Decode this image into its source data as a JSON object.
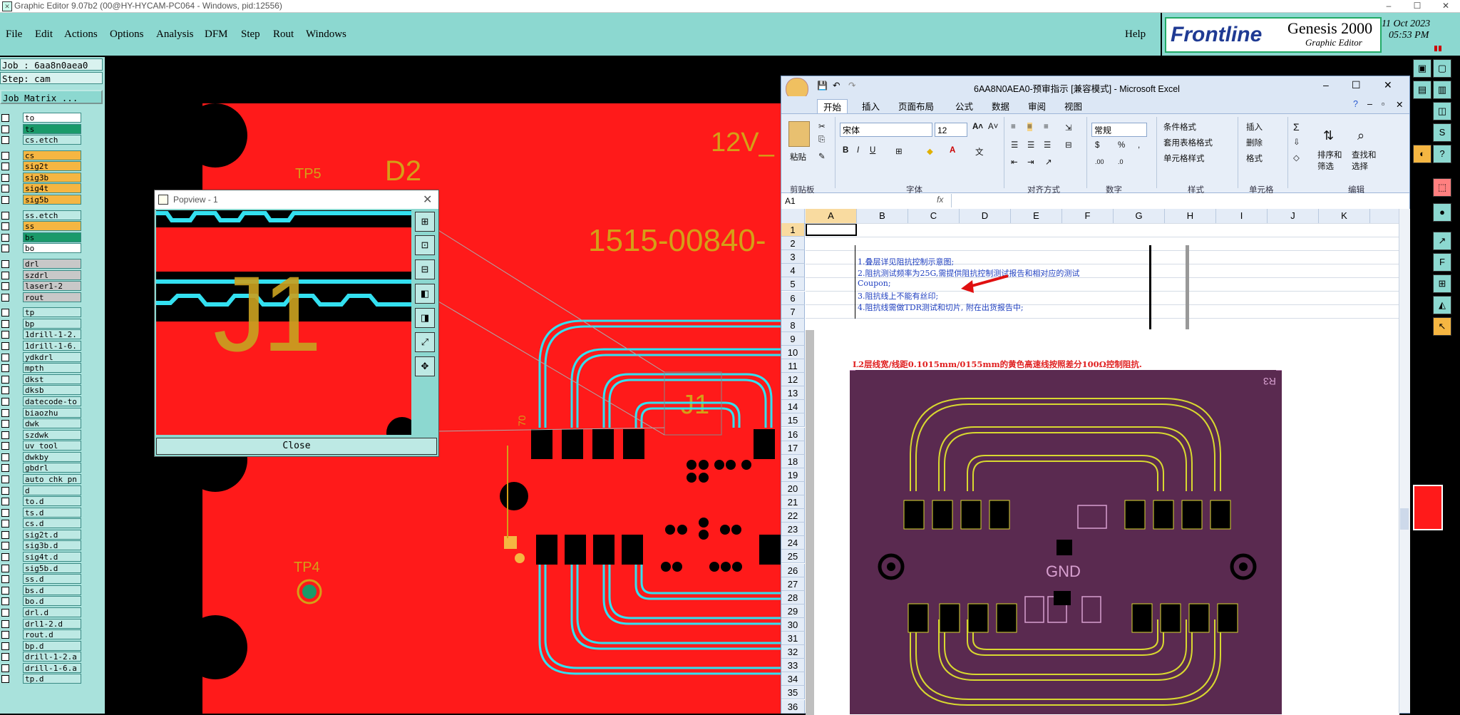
{
  "window": {
    "title": "Graphic Editor 9.07b2 (00@HY-HYCAM-PC064 - Windows, pid:12556)",
    "controls": [
      "–",
      "☐",
      "✕"
    ]
  },
  "menu": {
    "items": [
      "File",
      "Edit",
      "Actions",
      "Options",
      "Analysis",
      "DFM",
      "Step",
      "Rout",
      "Windows"
    ],
    "help": "Help"
  },
  "brand": {
    "logo": "Frontline",
    "product": "Genesis 2000",
    "subtitle": "Graphic Editor",
    "date": "11 Oct 2023",
    "time": "05:53 PM"
  },
  "job": {
    "job_line": "Job : 6aa8n0aea0",
    "step_line": "Step: cam",
    "matrix_button": "Job Matrix ..."
  },
  "layers": [
    {
      "name": "to",
      "color": "#ffffff"
    },
    {
      "name": "ts",
      "color": "#1a9a6a"
    },
    {
      "name": "cs.etch",
      "color": "#bde9e4"
    },
    {
      "name": "cs",
      "color": "#f5b642"
    },
    {
      "name": "sig2t",
      "color": "#f5b642"
    },
    {
      "name": "sig3b",
      "color": "#f5b642"
    },
    {
      "name": "sig4t",
      "color": "#f5b642"
    },
    {
      "name": "sig5b",
      "color": "#f5b642"
    },
    {
      "name": "ss.etch",
      "color": "#bde9e4"
    },
    {
      "name": "ss",
      "color": "#f5b642"
    },
    {
      "name": "bs",
      "color": "#1a9a6a"
    },
    {
      "name": "bo",
      "color": "#ffffff"
    },
    {
      "name": "drl",
      "color": "#c8c8c8"
    },
    {
      "name": "szdrl",
      "color": "#c8c8c8"
    },
    {
      "name": "laser1-2",
      "color": "#c8c8c8"
    },
    {
      "name": "rout",
      "color": "#c8c8c8"
    },
    {
      "name": "tp",
      "color": "#bde9e4"
    },
    {
      "name": "bp",
      "color": "#bde9e4"
    },
    {
      "name": "1drill-1-2.",
      "color": "#bde9e4"
    },
    {
      "name": "1drill-1-6.",
      "color": "#bde9e4"
    },
    {
      "name": "ydkdrl",
      "color": "#bde9e4"
    },
    {
      "name": "mpth",
      "color": "#bde9e4"
    },
    {
      "name": "dkst",
      "color": "#bde9e4"
    },
    {
      "name": "dksb",
      "color": "#bde9e4"
    },
    {
      "name": "datecode-to",
      "color": "#bde9e4"
    },
    {
      "name": "biaozhu",
      "color": "#bde9e4"
    },
    {
      "name": "dwk",
      "color": "#bde9e4"
    },
    {
      "name": "szdwk",
      "color": "#bde9e4"
    },
    {
      "name": "uv_tool",
      "color": "#bde9e4"
    },
    {
      "name": "dwkby",
      "color": "#bde9e4"
    },
    {
      "name": "gbdrl",
      "color": "#bde9e4"
    },
    {
      "name": "auto_chk_pn",
      "color": "#bde9e4"
    },
    {
      "name": "d",
      "color": "#bde9e4"
    },
    {
      "name": "to.d",
      "color": "#bde9e4"
    },
    {
      "name": "ts.d",
      "color": "#bde9e4"
    },
    {
      "name": "cs.d",
      "color": "#bde9e4"
    },
    {
      "name": "sig2t.d",
      "color": "#bde9e4"
    },
    {
      "name": "sig3b.d",
      "color": "#bde9e4"
    },
    {
      "name": "sig4t.d",
      "color": "#bde9e4"
    },
    {
      "name": "sig5b.d",
      "color": "#bde9e4"
    },
    {
      "name": "ss.d",
      "color": "#bde9e4"
    },
    {
      "name": "bs.d",
      "color": "#bde9e4"
    },
    {
      "name": "bo.d",
      "color": "#bde9e4"
    },
    {
      "name": "drl.d",
      "color": "#bde9e4"
    },
    {
      "name": "drl1-2.d",
      "color": "#bde9e4"
    },
    {
      "name": "rout.d",
      "color": "#bde9e4"
    },
    {
      "name": "bp.d",
      "color": "#bde9e4"
    },
    {
      "name": "drill-1-2.a",
      "color": "#bde9e4"
    },
    {
      "name": "drill-1-6.a",
      "color": "#bde9e4"
    },
    {
      "name": "tp.d",
      "color": "#bde9e4"
    }
  ],
  "pcb": {
    "labels": {
      "tp5": "TP5",
      "d2": "D2",
      "v12": "12V_",
      "part": "1515-00840-",
      "tp4": "TP4",
      "j1": "J1",
      "seventy": "70"
    },
    "colors": {
      "board": "#ff1a1a",
      "trace": "#33e0f0",
      "silk": "#d4a017"
    }
  },
  "popview": {
    "title": "Popview - 1",
    "close": "Close",
    "j1": "J1"
  },
  "excel": {
    "title": "6AA8N0AEA0-预审指示 [兼容模式] - Microsoft Excel",
    "tabs": [
      "开始",
      "插入",
      "页面布局",
      "公式",
      "数据",
      "审阅",
      "视图"
    ],
    "paste": "粘贴",
    "font_name": "宋体",
    "font_size": "12",
    "number_format": "常规",
    "style_buttons": [
      "条件格式",
      "套用表格格式",
      "单元格样式"
    ],
    "cell_buttons": [
      "插入",
      "删除",
      "格式"
    ],
    "edit_buttons": [
      "排序和\n筛选",
      "查找和\n选择"
    ],
    "groups": [
      "剪贴板",
      "字体",
      "对齐方式",
      "数字",
      "样式",
      "单元格",
      "编辑"
    ],
    "name_box": "A1",
    "fx": "fx",
    "columns": [
      "A",
      "B",
      "C",
      "D",
      "E",
      "F",
      "G",
      "H",
      "I",
      "J",
      "K"
    ],
    "rows": [
      "1",
      "2",
      "3",
      "4",
      "5",
      "6",
      "7",
      "8",
      "9",
      "10",
      "11",
      "12",
      "13",
      "14",
      "15",
      "16",
      "17",
      "18",
      "19",
      "20",
      "21",
      "22",
      "23",
      "24",
      "25",
      "26",
      "27",
      "28",
      "29",
      "30",
      "31",
      "32",
      "33",
      "34",
      "35",
      "36"
    ],
    "notes": [
      "1.叠层详见阻抗控制示意图;",
      "2.阻抗测试频率为25G,需提供阻抗控制测试报告和相对应的测试",
      "Coupon;",
      "3.阻抗线上不能有丝印;",
      "4.阻抗线需做TDR测试和切片, 附在出货报告中;"
    ],
    "red_note": "L2层线宽/线距0.1015mm/0155mm的黄色高速线按照差分100Ω控制阻抗.",
    "image_labels": {
      "gnd": "GND",
      "r3": "R3"
    }
  }
}
